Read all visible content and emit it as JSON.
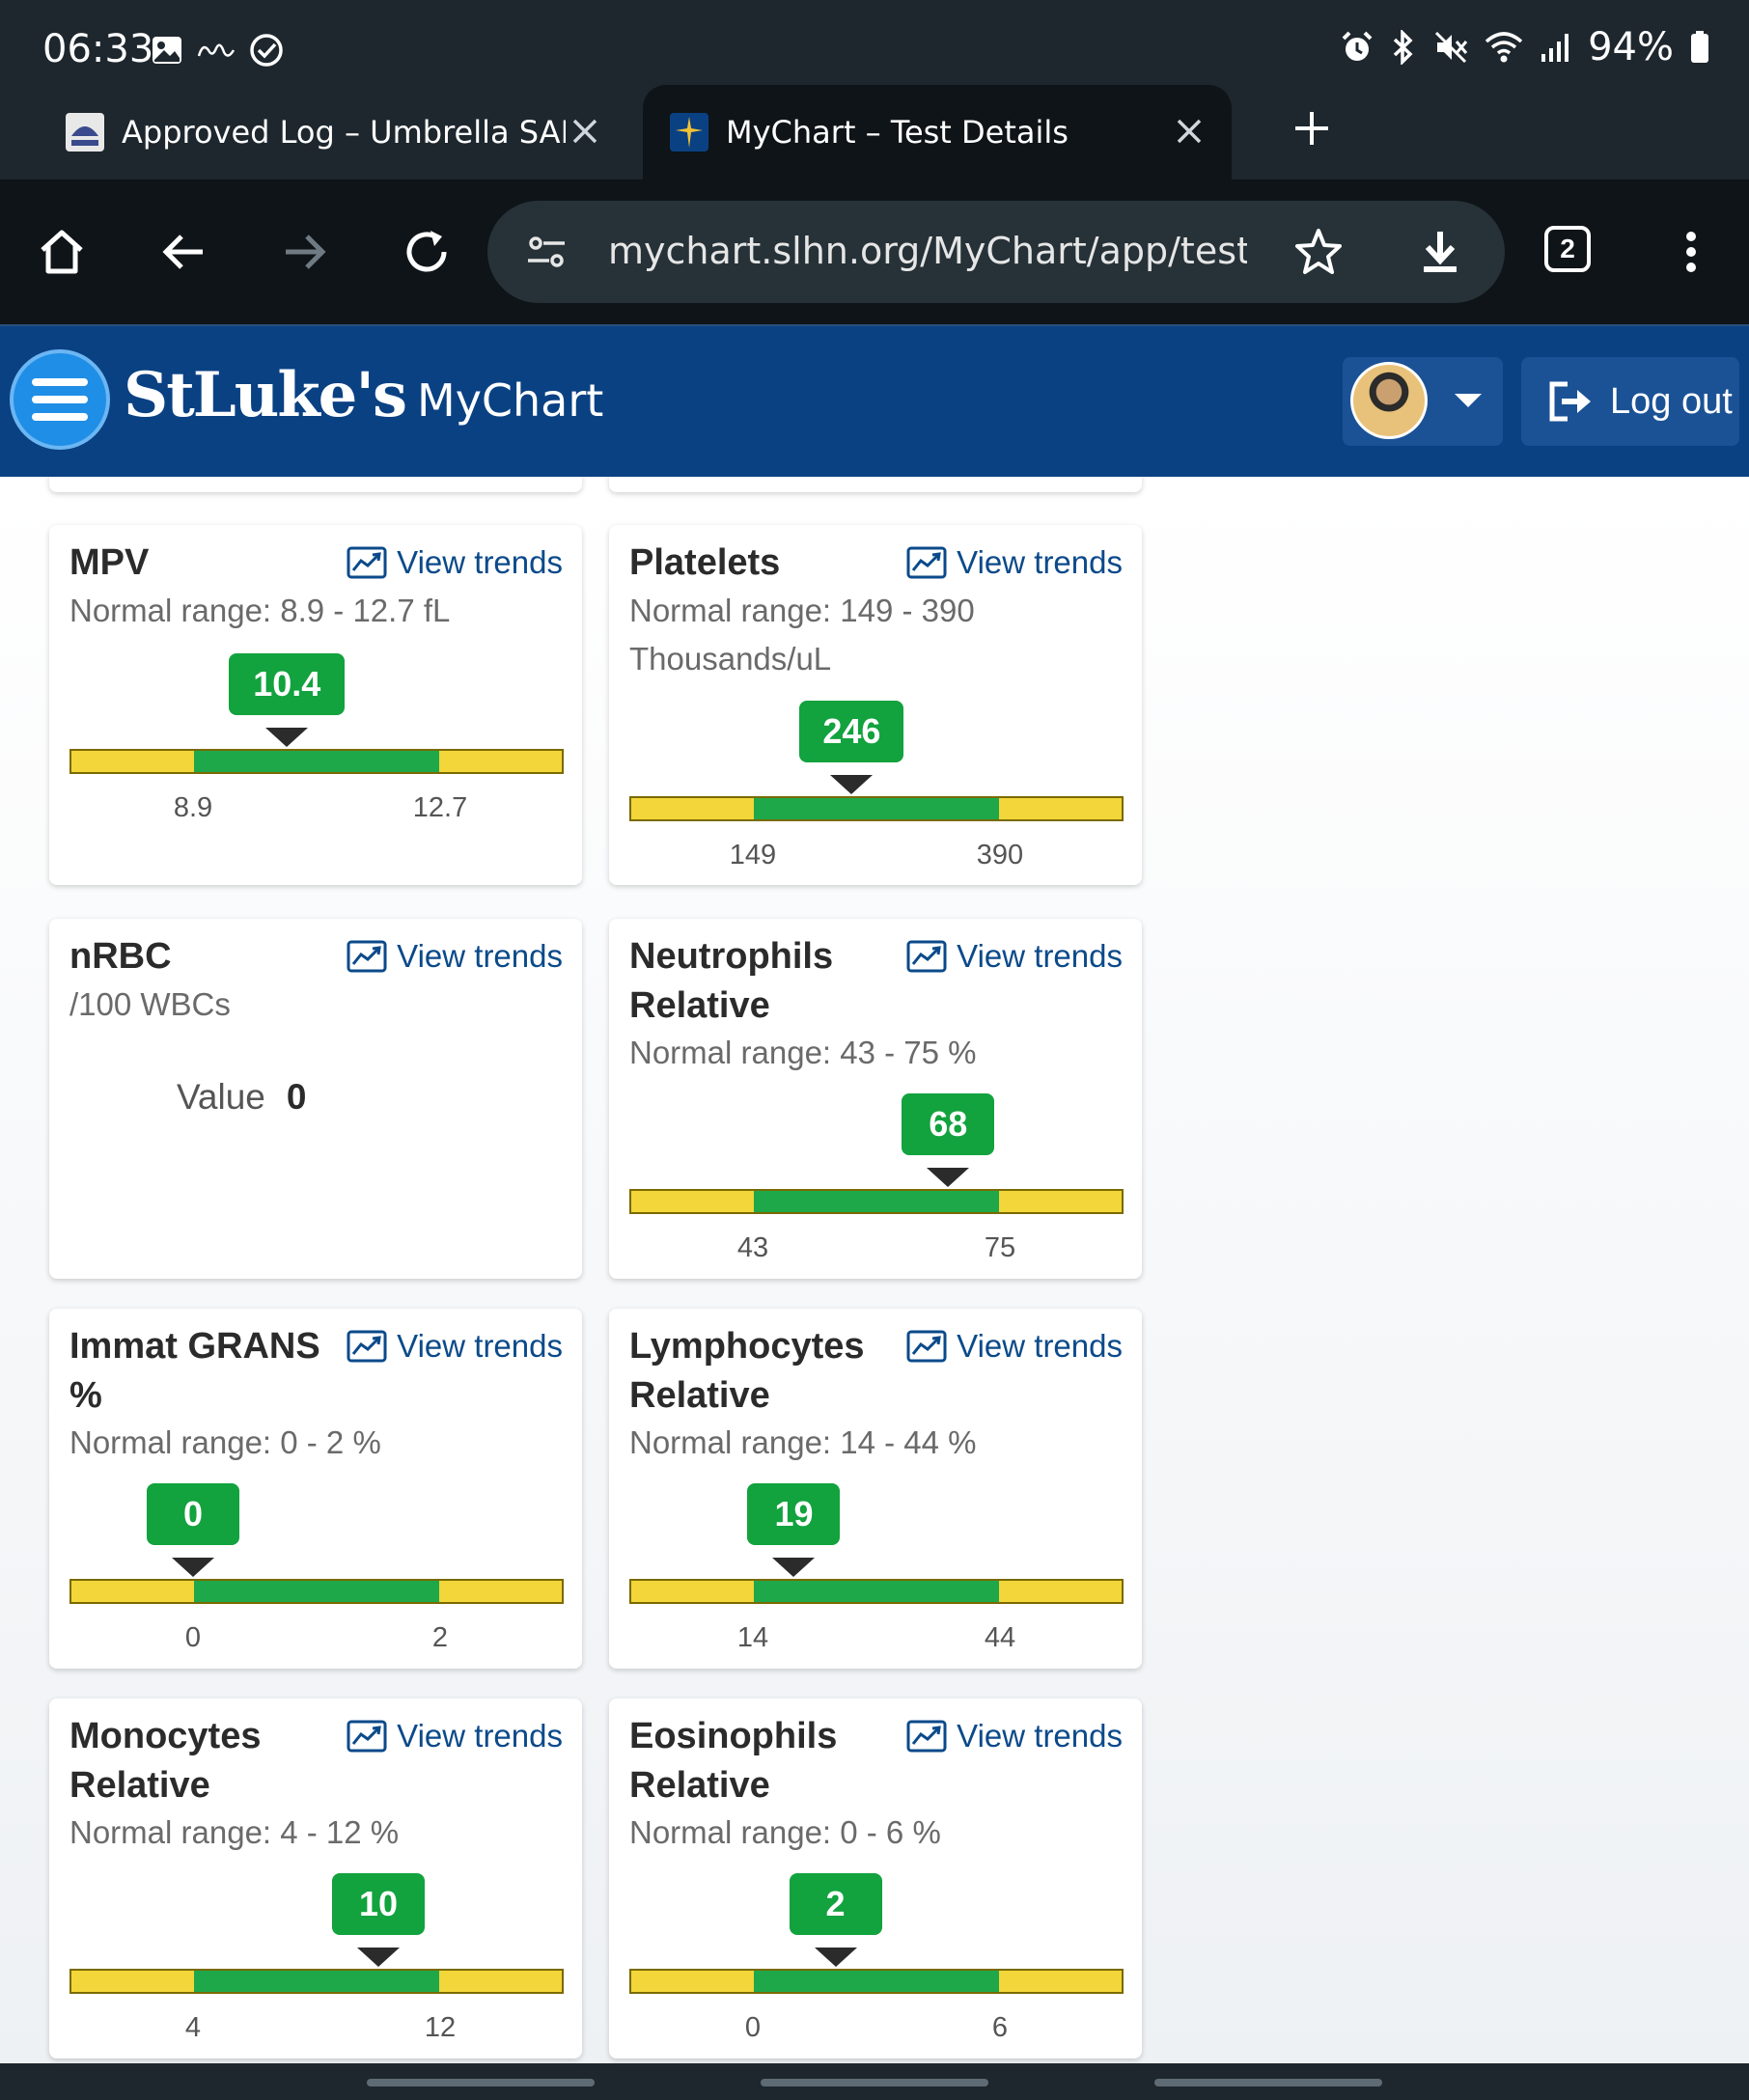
{
  "status_bar": {
    "time": "06:33",
    "left_icons": [
      "image-icon",
      "calm-icon",
      "check-circle-icon"
    ],
    "right_icons": [
      "alarm-icon",
      "bluetooth-icon",
      "mute-icon",
      "wifi-icon",
      "signal-icon"
    ],
    "battery": "94%"
  },
  "tabs": [
    {
      "title": "Approved Log – Umbrella SARM",
      "favicon": "umbrella-favicon",
      "active": false
    },
    {
      "title": "MyChart – Test Details",
      "favicon": "mychart-favicon",
      "active": true
    }
  ],
  "toolbar": {
    "url": "mychart.slhn.org/MyChart/app/test-results",
    "tab_count": "2"
  },
  "header": {
    "brand": "StLuke's",
    "product": "MyChart",
    "logout_label": "Log out"
  },
  "trend_link_label": "View trends",
  "cards": {
    "mpv": {
      "title": "MPV",
      "range": "Normal range: 8.9 - 12.7 fL",
      "value": "10.4",
      "low": "8.9",
      "high": "12.7",
      "value_fraction": 0.44
    },
    "platelets": {
      "title": "Platelets",
      "range": "Normal range: 149 - 390 Thousands/uL",
      "value": "246",
      "low": "149",
      "high": "390",
      "value_fraction": 0.45
    },
    "nrbc": {
      "title": "nRBC",
      "unit": "/100 WBCs",
      "value_label": "Value",
      "value": "0"
    },
    "neutrophils": {
      "title": "Neutrophils Relative",
      "range": "Normal range: 43 - 75 %",
      "value": "68",
      "low": "43",
      "high": "75",
      "value_fraction": 0.645
    },
    "immat_grans": {
      "title": "Immat GRANS %",
      "range": "Normal range: 0 - 2 %",
      "value": "0",
      "low": "0",
      "high": "2",
      "value_fraction": 0.25
    },
    "lymphocytes": {
      "title": "Lymphocytes Relative",
      "range": "Normal range: 14 - 44 %",
      "value": "19",
      "low": "14",
      "high": "44",
      "value_fraction": 0.333
    },
    "monocytes": {
      "title": "Monocytes Relative",
      "range": "Normal range: 4 - 12 %",
      "value": "10",
      "low": "4",
      "high": "12",
      "value_fraction": 0.625
    },
    "eosinophils": {
      "title": "Eosinophils Relative",
      "range": "Normal range: 0 - 6 %",
      "value": "2",
      "low": "0",
      "high": "6",
      "value_fraction": 0.417
    }
  },
  "colors": {
    "header_bg": "#0a4183",
    "in_range": "#1ea84a",
    "out_of_range": "#f2d63a",
    "value_badge": "#12a23e",
    "link": "#0b4a8a"
  }
}
